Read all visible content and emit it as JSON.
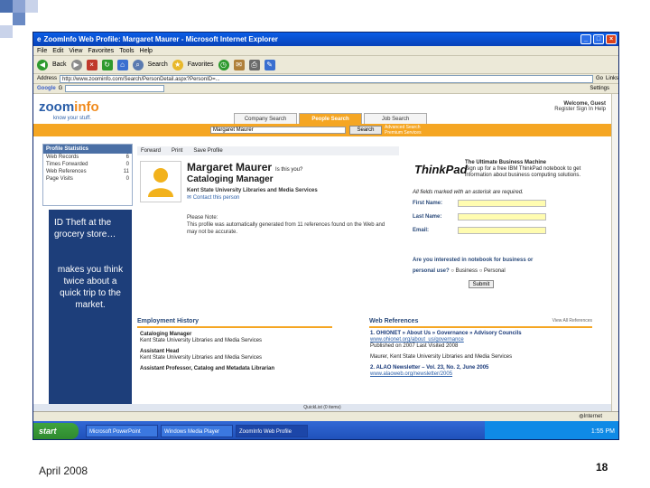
{
  "slide": {
    "date": "April 2008",
    "page_number": "18"
  },
  "window": {
    "title": "ZoomInfo Web Profile: Margaret Maurer - Microsoft Internet Explorer"
  },
  "menu": [
    "File",
    "Edit",
    "View",
    "Favorites",
    "Tools",
    "Help"
  ],
  "toolbar": {
    "back_label": "Back",
    "search_label": "Search",
    "favorites_label": "Favorites"
  },
  "address": {
    "label": "Address",
    "url": "http://www.zoominfo.com/Search/PersonDetail.aspx?PersonID=...",
    "go_label": "Go",
    "links_label": "Links"
  },
  "google_bar": {
    "label": "Google",
    "g_label": "G",
    "settings_label": "Settings"
  },
  "site": {
    "logo_zoom": "zoom",
    "logo_info": "info",
    "tagline": "know your stuff.",
    "welcome": "Welcome, Guest",
    "welcome_links": "Register   Sign In   Help",
    "tabs": [
      "Company Search",
      "People Search",
      "Job Search"
    ],
    "search_value": "Margaret Maurer",
    "search_button": "Search",
    "search_links": [
      "Advanced Search",
      "Premium Services"
    ]
  },
  "profile_stats": {
    "title": "Profile Statistics",
    "rows": [
      {
        "label": "Web Records",
        "value": "6"
      },
      {
        "label": "Times Forwarded",
        "value": "0"
      },
      {
        "label": "Web References",
        "value": "11"
      },
      {
        "label": "Page Visits",
        "value": "0"
      }
    ]
  },
  "ad": {
    "top": "ID Theft at the grocery store…",
    "bottom": "makes you think twice about a quick trip to the market."
  },
  "actions": [
    "Forward",
    "Print",
    "Save Profile"
  ],
  "profile": {
    "name": "Margaret Maurer",
    "is_this_you": "Is this you?",
    "title": "Cataloging Manager",
    "org": "Kent State University Libraries and Media Services",
    "contact": "Contact this person",
    "note_head": "Please Note:",
    "note_body": "This profile was automatically generated from 11 references found on the Web and may not be accurate."
  },
  "employment": {
    "heading": "Employment History",
    "items": [
      {
        "title": "Cataloging Manager",
        "org": "Kent State University Libraries and Media Services"
      },
      {
        "title": "Assistant Head",
        "org": "Kent State University Libraries and Media Services"
      },
      {
        "title": "Assistant Professor, Catalog and Metadata Librarian",
        "org": ""
      }
    ]
  },
  "thinkpad": {
    "logo": "ThinkPad",
    "head_bold": "The Ultimate Business Machine",
    "head_body": "Sign up for a free IBM ThinkPad notebook to get information about business computing solutions.",
    "required": "All fields marked with an asterisk are required.",
    "fields": [
      "First Name:",
      "Last Name:",
      "Email:"
    ],
    "question": "Are you interested in notebook for business or personal use?",
    "options": [
      "Business",
      "Personal"
    ],
    "submit": "Submit"
  },
  "web_refs": {
    "heading": "Web References",
    "view_all": "View All References",
    "items": [
      {
        "title": "1. OHIONET » About Us » Governance » Advisory Councils",
        "url": "www.ohionet.org/about_us/governance",
        "meta": "Published on 2007   Last Visited 2008"
      },
      {
        "title": "",
        "url": "",
        "meta": "Maurer, Kent State University Libraries and Media Services"
      },
      {
        "title": "2. ALAO Newsletter – Vol. 23, No. 2, June 2005",
        "url": "www.alaoweb.org/newsletter/2005",
        "meta": ""
      }
    ]
  },
  "quicklist": "QuickList (0 items)",
  "status": {
    "zone": "Internet"
  },
  "taskbar": {
    "start": "start",
    "tasks": [
      "Microsoft PowerPoint",
      "Windows Media Player",
      "ZoomInfo Web Profile"
    ],
    "clock": "1:55 PM"
  }
}
